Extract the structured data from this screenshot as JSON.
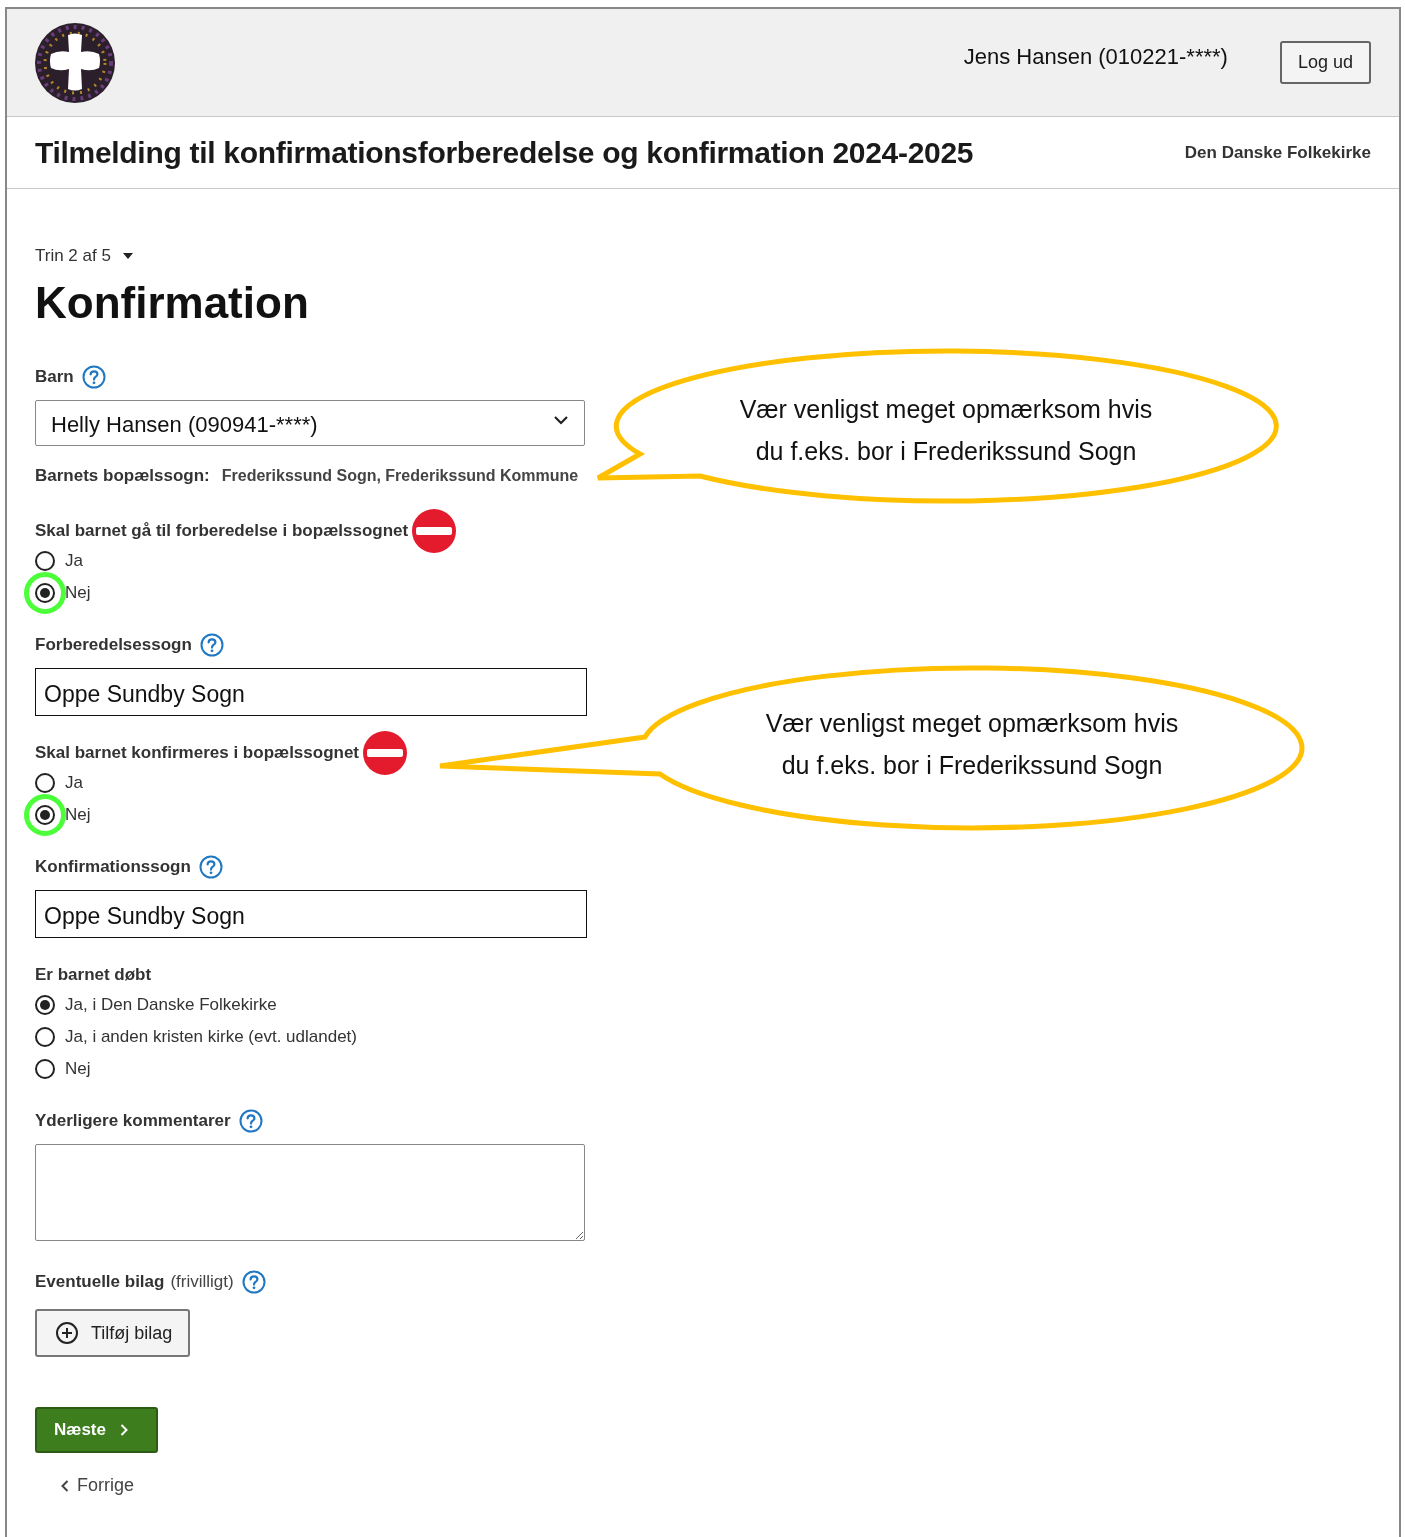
{
  "header": {
    "user": "Jens Hansen (010221-****)",
    "logout": "Log ud"
  },
  "title_bar": {
    "title": "Tilmelding til konfirmationsforberedelse og konfirmation 2024-2025",
    "organisation": "Den Danske Folkekirke"
  },
  "step": "Trin 2 af 5",
  "heading": "Konfirmation",
  "fields": [
    {
      "kind": "select",
      "label": "Barn",
      "help": true,
      "warning": false,
      "value": "Helly Hansen (090941-****)"
    },
    {
      "kind": "info",
      "label": "Barnets bopælssogn:",
      "value": "Frederikssund Sogn, Frederikssund Kommune"
    },
    {
      "kind": "radio",
      "label": "Skal barnet gå til forberedelse i bopælssognet",
      "help": false,
      "warning": true,
      "options": [
        {
          "label": "Ja",
          "selected": false,
          "highlighted": false
        },
        {
          "label": "Nej",
          "selected": true,
          "highlighted": true
        }
      ]
    },
    {
      "kind": "text",
      "label": "Forberedelsessogn",
      "help": true,
      "warning": false,
      "value": "Oppe Sundby Sogn"
    },
    {
      "kind": "radio",
      "label": "Skal barnet konfirmeres i bopælssognet",
      "help": false,
      "warning": true,
      "options": [
        {
          "label": "Ja",
          "selected": false,
          "highlighted": false
        },
        {
          "label": "Nej",
          "selected": true,
          "highlighted": true
        }
      ]
    },
    {
      "kind": "text",
      "label": "Konfirmationssogn",
      "help": true,
      "warning": false,
      "value": "Oppe Sundby Sogn"
    },
    {
      "kind": "radio",
      "label": "Er barnet døbt",
      "help": false,
      "warning": false,
      "options": [
        {
          "label": "Ja, i Den Danske Folkekirke",
          "selected": true,
          "highlighted": false
        },
        {
          "label": "Ja, i anden kristen kirke (evt. udlandet)",
          "selected": false,
          "highlighted": false
        },
        {
          "label": "Nej",
          "selected": false,
          "highlighted": false
        }
      ]
    },
    {
      "kind": "textarea",
      "label": "Yderligere kommentarer",
      "help": true,
      "warning": false
    },
    {
      "kind": "file",
      "label": "Eventuelle bilag",
      "note": "(frivilligt)",
      "help": true,
      "warning": false,
      "button": "Tilføj bilag"
    }
  ],
  "next": "Næste",
  "previous": "Forrige",
  "callouts": [
    {
      "lines": [
        "Vær venligst meget opmærksom hvis",
        "du f.eks. bor i Frederikssund Sogn"
      ]
    },
    {
      "lines": [
        "Vær venligst meget opmærksom hvis",
        "du f.eks. bor i Frederikssund Sogn"
      ]
    }
  ]
}
